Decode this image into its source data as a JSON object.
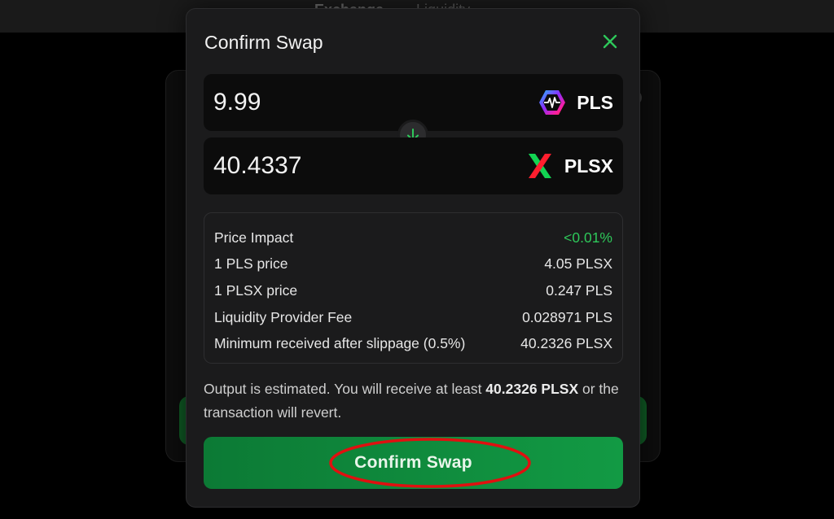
{
  "background": {
    "tabs": [
      "Exchange",
      "Liquidity"
    ]
  },
  "modal": {
    "title": "Confirm Swap",
    "close_icon": "close-icon",
    "input": {
      "amount": "9.99",
      "symbol": "PLS",
      "icon": "pls-logo-icon"
    },
    "direction_icon": "arrow-down-icon",
    "output": {
      "amount": "40.4337",
      "symbol": "PLSX",
      "icon": "plsx-logo-icon"
    },
    "details": [
      {
        "label": "Price Impact",
        "value": "<0.01%",
        "color": "#2ec85a"
      },
      {
        "label": "1 PLS price",
        "value": "4.05 PLSX"
      },
      {
        "label": "1 PLSX price",
        "value": "0.247 PLS"
      },
      {
        "label": "Liquidity Provider Fee",
        "value": "0.028971 PLS"
      },
      {
        "label": "Minimum received after slippage (0.5%)",
        "value": "40.2326 PLSX"
      }
    ],
    "note": {
      "prefix": "Output is estimated. You will receive at least ",
      "amount": "40.2326 PLSX",
      "suffix": " or the transaction will revert."
    },
    "confirm_label": "Confirm Swap"
  },
  "colors": {
    "accent_green": "#2ec85a",
    "button_green": "#129a44",
    "annotation_red": "#e01010"
  }
}
